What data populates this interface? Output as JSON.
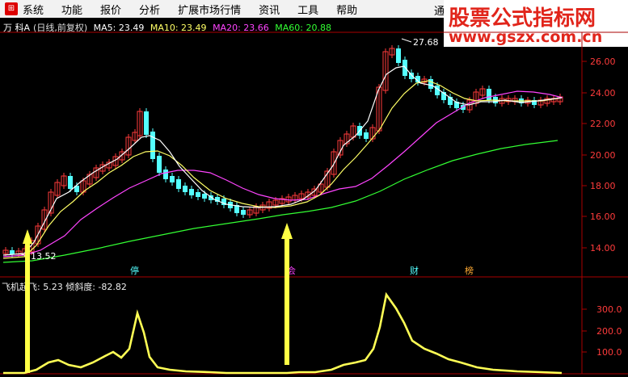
{
  "menu": {
    "items": [
      "系统",
      "功能",
      "报价",
      "分析",
      "扩展市场行情",
      "资讯",
      "工具",
      "帮助"
    ],
    "right_item": "通"
  },
  "brand": {
    "title": "股票公式指标网",
    "url": "www.gszx.com.cn"
  },
  "info": {
    "stock": "万 科A",
    "period": "(日线,前复权)",
    "ma5": "MA5: 23.49",
    "ma10": "MA10: 23.49",
    "ma20": "MA20: 23.66",
    "ma60": "MA60: 20.88"
  },
  "colors": {
    "ma5": "#ffffff",
    "ma10": "#ffff66",
    "ma20": "#ff44ff",
    "ma60": "#33ff33",
    "up": "#ff3b3b",
    "down": "#54ffff",
    "axis": "#ff3b3b",
    "indicator": "#ffff55"
  },
  "price_axis": {
    "ticks": [
      "26.00",
      "24.00",
      "22.00",
      "20.00",
      "18.00",
      "16.00",
      "14.00"
    ]
  },
  "indicator_axis": {
    "ticks": [
      "300.0",
      "200.0",
      "100.0"
    ]
  },
  "annotations": {
    "high": "27.68",
    "low": "13.52"
  },
  "event_tags": [
    "停",
    "会",
    "财",
    "榜"
  ],
  "indicator": {
    "name": "飞机起飞",
    "value": ": 5.23",
    "slope": "倾斜度: -82.82"
  }
}
